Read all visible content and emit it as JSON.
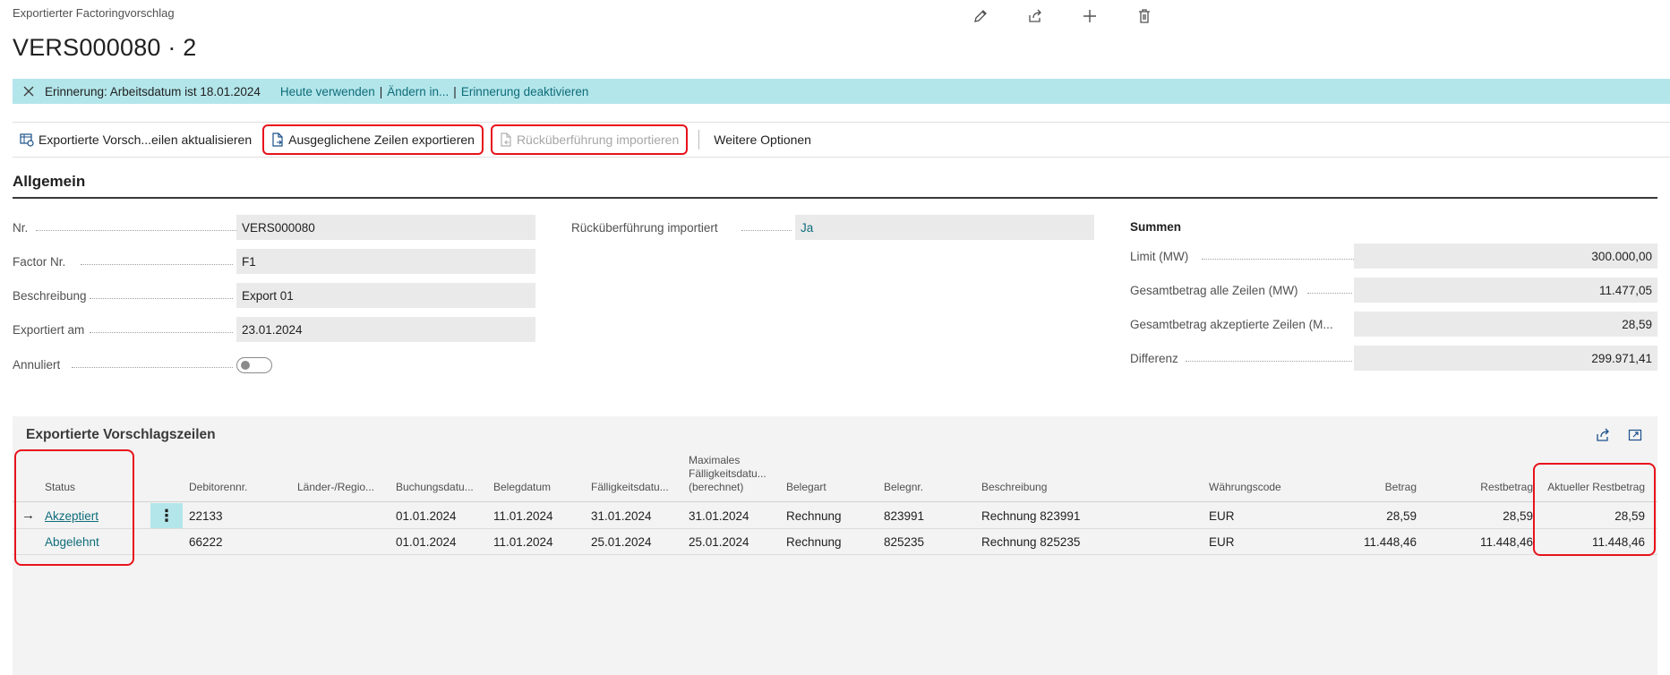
{
  "page": {
    "caption": "Exportierter Factoringvorschlag",
    "title": "VERS000080 · 2"
  },
  "top_actions": [
    {
      "name": "edit-icon"
    },
    {
      "name": "share-icon"
    },
    {
      "name": "plus-icon"
    },
    {
      "name": "trash-icon"
    }
  ],
  "banner": {
    "message": "Erinnerung: Arbeitsdatum ist 18.01.2024",
    "link_today": "Heute verwenden",
    "sep1": "|",
    "link_change": "Ändern in...",
    "sep2": "|",
    "link_disable": "Erinnerung deaktivieren",
    "color": "#b3e6ea"
  },
  "toolbar": {
    "update_label": "Exportierte Vorsch...eilen aktualisieren",
    "export_label": "Ausgeglichene Zeilen exportieren",
    "import_label": "Rücküberführung importieren",
    "more_label": "Weitere Optionen"
  },
  "general": {
    "title": "Allgemein",
    "nr_label": "Nr.",
    "nr_value": "VERS000080",
    "factor_label": "Factor Nr.",
    "factor_value": "F1",
    "desc_label": "Beschreibung",
    "desc_value": "Export 01",
    "exported_label": "Exportiert am",
    "exported_value": "23.01.2024",
    "cancelled_label": "Annuliert",
    "cancelled_value": false,
    "return_label": "Rücküberführung importiert",
    "return_value": "Ja"
  },
  "sums": {
    "title": "Summen",
    "limit_label": "Limit (MW)",
    "limit_value": "300.000,00",
    "total_label": "Gesamtbetrag alle Zeilen (MW)",
    "total_value": "11.477,05",
    "accepted_label": "Gesamtbetrag akzeptierte Zeilen (M...",
    "accepted_value": "28,59",
    "diff_label": "Differenz",
    "diff_value": "299.971,41"
  },
  "lines": {
    "title": "Exportierte Vorschlagszeilen",
    "headers": {
      "status": "Status",
      "debitor": "Debitorennr.",
      "region": "Länder-/Regio...",
      "posting": "Buchungsdatu...",
      "docdate": "Belegdatum",
      "due": "Fälligkeitsdatu...",
      "maxdue": "Maximales Fälligkeitsdatu... (berechnet)",
      "doctype": "Belegart",
      "docno": "Belegnr.",
      "desc": "Beschreibung",
      "currency": "Währungscode",
      "amount": "Betrag",
      "remaining": "Restbetrag",
      "current_remaining": "Aktueller Restbetrag"
    },
    "rows": [
      {
        "status": "Akzeptiert",
        "debitor": "22133",
        "region": "",
        "posting": "01.01.2024",
        "docdate": "11.01.2024",
        "due": "31.01.2024",
        "maxdue": "31.01.2024",
        "doctype": "Rechnung",
        "docno": "823991",
        "desc": "Rechnung 823991",
        "currency": "EUR",
        "amount": "28,59",
        "remaining": "28,59",
        "current_remaining": "28,59"
      },
      {
        "status": "Abgelehnt",
        "debitor": "66222",
        "region": "",
        "posting": "01.01.2024",
        "docdate": "11.01.2024",
        "due": "25.01.2024",
        "maxdue": "25.01.2024",
        "doctype": "Rechnung",
        "docno": "825235",
        "desc": "Rechnung 825235",
        "currency": "EUR",
        "amount": "11.448,46",
        "remaining": "11.448,46",
        "current_remaining": "11.448,46"
      }
    ]
  },
  "colors": {
    "accent": "#0f6c7a",
    "highlight_box": "#e8121b"
  }
}
